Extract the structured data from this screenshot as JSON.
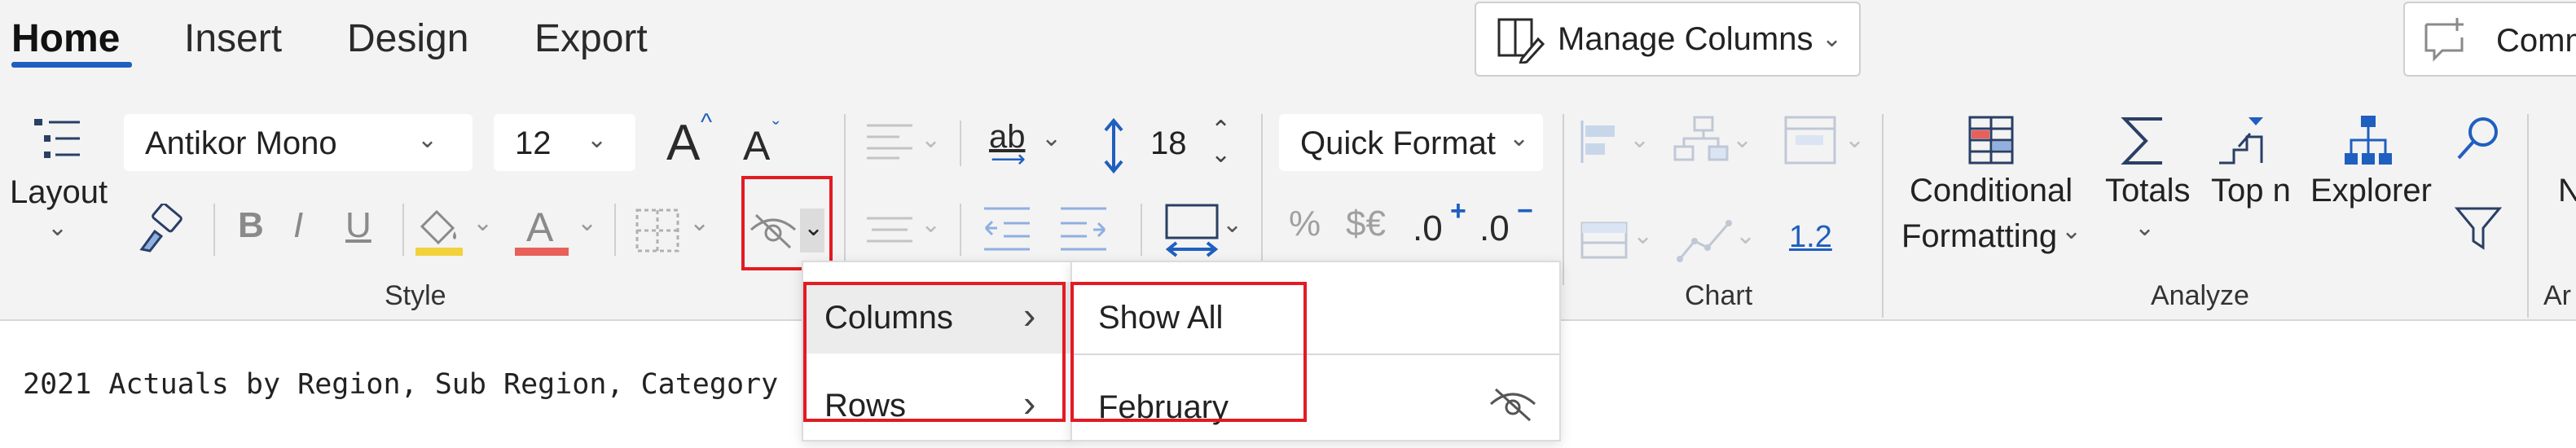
{
  "tabs": {
    "home": "Home",
    "insert": "Insert",
    "design": "Design",
    "export": "Export"
  },
  "manage_columns": {
    "label": "Manage Columns",
    "icon": "edit-columns-icon"
  },
  "comments_button": {
    "label": "Comm",
    "icon": "add-comment-icon"
  },
  "style_group": {
    "label": "Style",
    "layout_label": "Layout",
    "font_family": "Antikor Mono",
    "font_size": "12",
    "increase_font": "A",
    "decrease_font": "A",
    "bold": "B",
    "italic": "I",
    "underline": "U",
    "highlight_color": "#f2d23c",
    "font_color": "#e8605a"
  },
  "text_group": {
    "wrap_label": "ab",
    "row_height": "18",
    "percent": "%",
    "currency": "$€",
    "increase_decimals": ".0",
    "decrease_decimals": ".0",
    "increase_mark": "+",
    "decrease_mark": "−"
  },
  "quick_format": {
    "label": "Quick Format"
  },
  "chart_group": {
    "label": "Chart",
    "value_label": "1.2"
  },
  "analyze_group": {
    "label": "Analyze",
    "conditional_formatting_line1": "Conditional",
    "conditional_formatting_line2": "Formatting",
    "totals": "Totals",
    "top_n": "Top n",
    "explorer": "Explorer"
  },
  "ar_group": {
    "label": "Ar",
    "clipped": "N"
  },
  "hide_menu": {
    "columns": "Columns",
    "rows": "Rows",
    "submenu_show_all": "Show All",
    "submenu_february": "February"
  },
  "sheet": {
    "title_text": "2021 Actuals by Region, Sub Region, Category"
  },
  "colors": {
    "accent": "#1f5fbf",
    "highlight_box": "#e31b23"
  }
}
